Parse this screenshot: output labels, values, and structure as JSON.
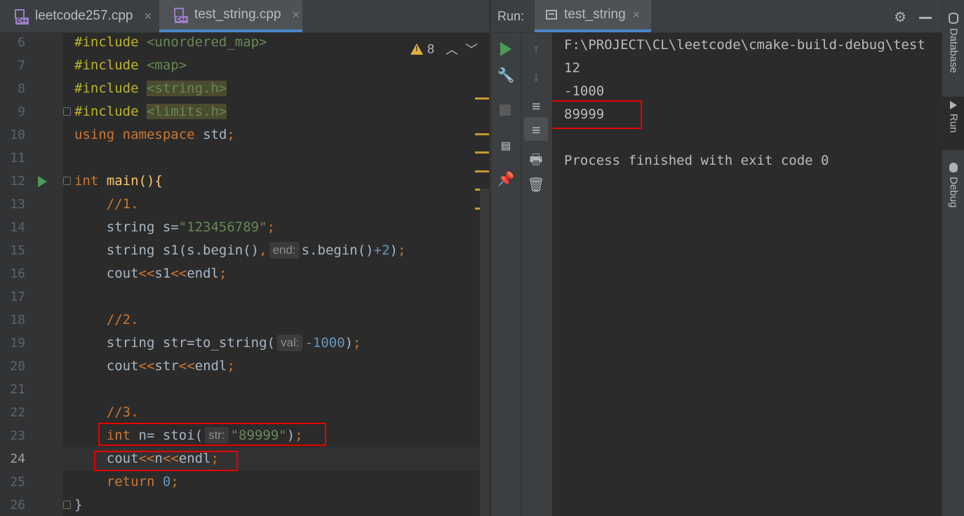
{
  "editor_tabs": [
    {
      "label": "leetcode257.cpp",
      "icon": "cpp-file-icon",
      "active": false
    },
    {
      "label": "test_string.cpp",
      "icon": "cpp-file-icon",
      "active": true
    }
  ],
  "close_glyph": "×",
  "file_icon_text": "C++",
  "inspections": {
    "warnings": "8",
    "up": "︿",
    "down": "﹀"
  },
  "code_lines": [
    {
      "n": "6"
    },
    {
      "n": "7"
    },
    {
      "n": "8"
    },
    {
      "n": "9"
    },
    {
      "n": "10"
    },
    {
      "n": "11"
    },
    {
      "n": "12"
    },
    {
      "n": "13"
    },
    {
      "n": "14"
    },
    {
      "n": "15"
    },
    {
      "n": "16"
    },
    {
      "n": "17"
    },
    {
      "n": "18"
    },
    {
      "n": "19"
    },
    {
      "n": "20"
    },
    {
      "n": "21"
    },
    {
      "n": "22"
    },
    {
      "n": "23"
    },
    {
      "n": "24"
    },
    {
      "n": "25"
    },
    {
      "n": "26"
    }
  ],
  "code": {
    "include": "#include",
    "unordered_map": "<unordered_map>",
    "map": "<map>",
    "string_h": "<string.h>",
    "limits_h": "<limits.h>",
    "using": "using",
    "namespace": "namespace",
    "std": "std",
    "semi": ";",
    "int": "int",
    "main": "main(){",
    "c1": "//1.",
    "l14a": "string s=",
    "l14s": "\"123456789\"",
    "l15a": "string s1(s.begin()",
    "comma": ",",
    "hint_end": "end:",
    "l15b": "s.begin()",
    "plus": "+",
    "two": "2",
    "l15c": ")",
    "l16a": "cout",
    "ltlt": "<<",
    "s1": "s1",
    "endl": "endl",
    "c2": "//2.",
    "l19a": "string str=to_string(",
    "hint_val": "val:",
    "neg": "-1000",
    "rparen": ")",
    "str": "str",
    "c3": "//3.",
    "l23a": "n= stoi(",
    "hint_str": "str:",
    "l23s": "\"89999\"",
    "n": "n",
    "return": "return",
    "zero": "0",
    "rbrace": "}"
  },
  "run": {
    "label": "Run:",
    "tab": "test_string",
    "settings_icon": "⚙",
    "output": [
      "F:\\PROJECT\\CL\\leetcode\\cmake-build-debug\\test",
      "12",
      "-1000",
      "89999",
      "",
      "Process finished with exit code 0"
    ],
    "icons": {
      "up": "↑",
      "down": "↓",
      "wrench": "🔧",
      "pin": "📌",
      "print": "🖶",
      "trash": "🗑",
      "layout": "▤",
      "soft_wrap": "≡"
    }
  },
  "right_strip": [
    "Database",
    "Run",
    "Debug"
  ]
}
